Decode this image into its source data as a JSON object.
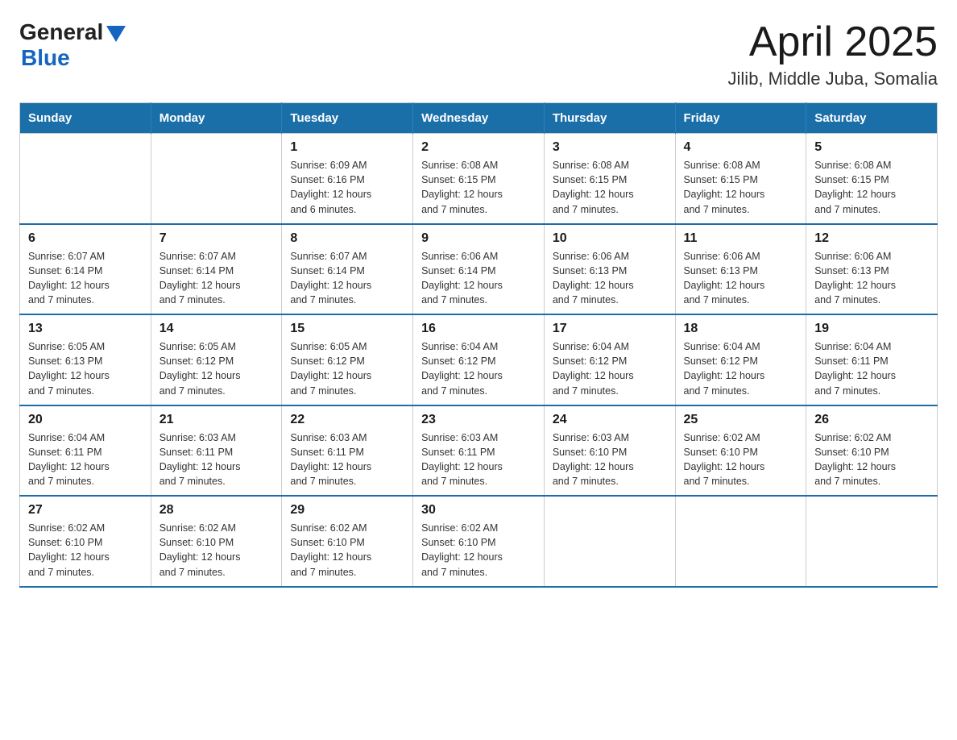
{
  "header": {
    "logo_general": "General",
    "logo_blue": "Blue",
    "title": "April 2025",
    "subtitle": "Jilib, Middle Juba, Somalia"
  },
  "calendar": {
    "days_of_week": [
      "Sunday",
      "Monday",
      "Tuesday",
      "Wednesday",
      "Thursday",
      "Friday",
      "Saturday"
    ],
    "weeks": [
      [
        {
          "day": "",
          "info": ""
        },
        {
          "day": "",
          "info": ""
        },
        {
          "day": "1",
          "info": "Sunrise: 6:09 AM\nSunset: 6:16 PM\nDaylight: 12 hours\nand 6 minutes."
        },
        {
          "day": "2",
          "info": "Sunrise: 6:08 AM\nSunset: 6:15 PM\nDaylight: 12 hours\nand 7 minutes."
        },
        {
          "day": "3",
          "info": "Sunrise: 6:08 AM\nSunset: 6:15 PM\nDaylight: 12 hours\nand 7 minutes."
        },
        {
          "day": "4",
          "info": "Sunrise: 6:08 AM\nSunset: 6:15 PM\nDaylight: 12 hours\nand 7 minutes."
        },
        {
          "day": "5",
          "info": "Sunrise: 6:08 AM\nSunset: 6:15 PM\nDaylight: 12 hours\nand 7 minutes."
        }
      ],
      [
        {
          "day": "6",
          "info": "Sunrise: 6:07 AM\nSunset: 6:14 PM\nDaylight: 12 hours\nand 7 minutes."
        },
        {
          "day": "7",
          "info": "Sunrise: 6:07 AM\nSunset: 6:14 PM\nDaylight: 12 hours\nand 7 minutes."
        },
        {
          "day": "8",
          "info": "Sunrise: 6:07 AM\nSunset: 6:14 PM\nDaylight: 12 hours\nand 7 minutes."
        },
        {
          "day": "9",
          "info": "Sunrise: 6:06 AM\nSunset: 6:14 PM\nDaylight: 12 hours\nand 7 minutes."
        },
        {
          "day": "10",
          "info": "Sunrise: 6:06 AM\nSunset: 6:13 PM\nDaylight: 12 hours\nand 7 minutes."
        },
        {
          "day": "11",
          "info": "Sunrise: 6:06 AM\nSunset: 6:13 PM\nDaylight: 12 hours\nand 7 minutes."
        },
        {
          "day": "12",
          "info": "Sunrise: 6:06 AM\nSunset: 6:13 PM\nDaylight: 12 hours\nand 7 minutes."
        }
      ],
      [
        {
          "day": "13",
          "info": "Sunrise: 6:05 AM\nSunset: 6:13 PM\nDaylight: 12 hours\nand 7 minutes."
        },
        {
          "day": "14",
          "info": "Sunrise: 6:05 AM\nSunset: 6:12 PM\nDaylight: 12 hours\nand 7 minutes."
        },
        {
          "day": "15",
          "info": "Sunrise: 6:05 AM\nSunset: 6:12 PM\nDaylight: 12 hours\nand 7 minutes."
        },
        {
          "day": "16",
          "info": "Sunrise: 6:04 AM\nSunset: 6:12 PM\nDaylight: 12 hours\nand 7 minutes."
        },
        {
          "day": "17",
          "info": "Sunrise: 6:04 AM\nSunset: 6:12 PM\nDaylight: 12 hours\nand 7 minutes."
        },
        {
          "day": "18",
          "info": "Sunrise: 6:04 AM\nSunset: 6:12 PM\nDaylight: 12 hours\nand 7 minutes."
        },
        {
          "day": "19",
          "info": "Sunrise: 6:04 AM\nSunset: 6:11 PM\nDaylight: 12 hours\nand 7 minutes."
        }
      ],
      [
        {
          "day": "20",
          "info": "Sunrise: 6:04 AM\nSunset: 6:11 PM\nDaylight: 12 hours\nand 7 minutes."
        },
        {
          "day": "21",
          "info": "Sunrise: 6:03 AM\nSunset: 6:11 PM\nDaylight: 12 hours\nand 7 minutes."
        },
        {
          "day": "22",
          "info": "Sunrise: 6:03 AM\nSunset: 6:11 PM\nDaylight: 12 hours\nand 7 minutes."
        },
        {
          "day": "23",
          "info": "Sunrise: 6:03 AM\nSunset: 6:11 PM\nDaylight: 12 hours\nand 7 minutes."
        },
        {
          "day": "24",
          "info": "Sunrise: 6:03 AM\nSunset: 6:10 PM\nDaylight: 12 hours\nand 7 minutes."
        },
        {
          "day": "25",
          "info": "Sunrise: 6:02 AM\nSunset: 6:10 PM\nDaylight: 12 hours\nand 7 minutes."
        },
        {
          "day": "26",
          "info": "Sunrise: 6:02 AM\nSunset: 6:10 PM\nDaylight: 12 hours\nand 7 minutes."
        }
      ],
      [
        {
          "day": "27",
          "info": "Sunrise: 6:02 AM\nSunset: 6:10 PM\nDaylight: 12 hours\nand 7 minutes."
        },
        {
          "day": "28",
          "info": "Sunrise: 6:02 AM\nSunset: 6:10 PM\nDaylight: 12 hours\nand 7 minutes."
        },
        {
          "day": "29",
          "info": "Sunrise: 6:02 AM\nSunset: 6:10 PM\nDaylight: 12 hours\nand 7 minutes."
        },
        {
          "day": "30",
          "info": "Sunrise: 6:02 AM\nSunset: 6:10 PM\nDaylight: 12 hours\nand 7 minutes."
        },
        {
          "day": "",
          "info": ""
        },
        {
          "day": "",
          "info": ""
        },
        {
          "day": "",
          "info": ""
        }
      ]
    ]
  }
}
